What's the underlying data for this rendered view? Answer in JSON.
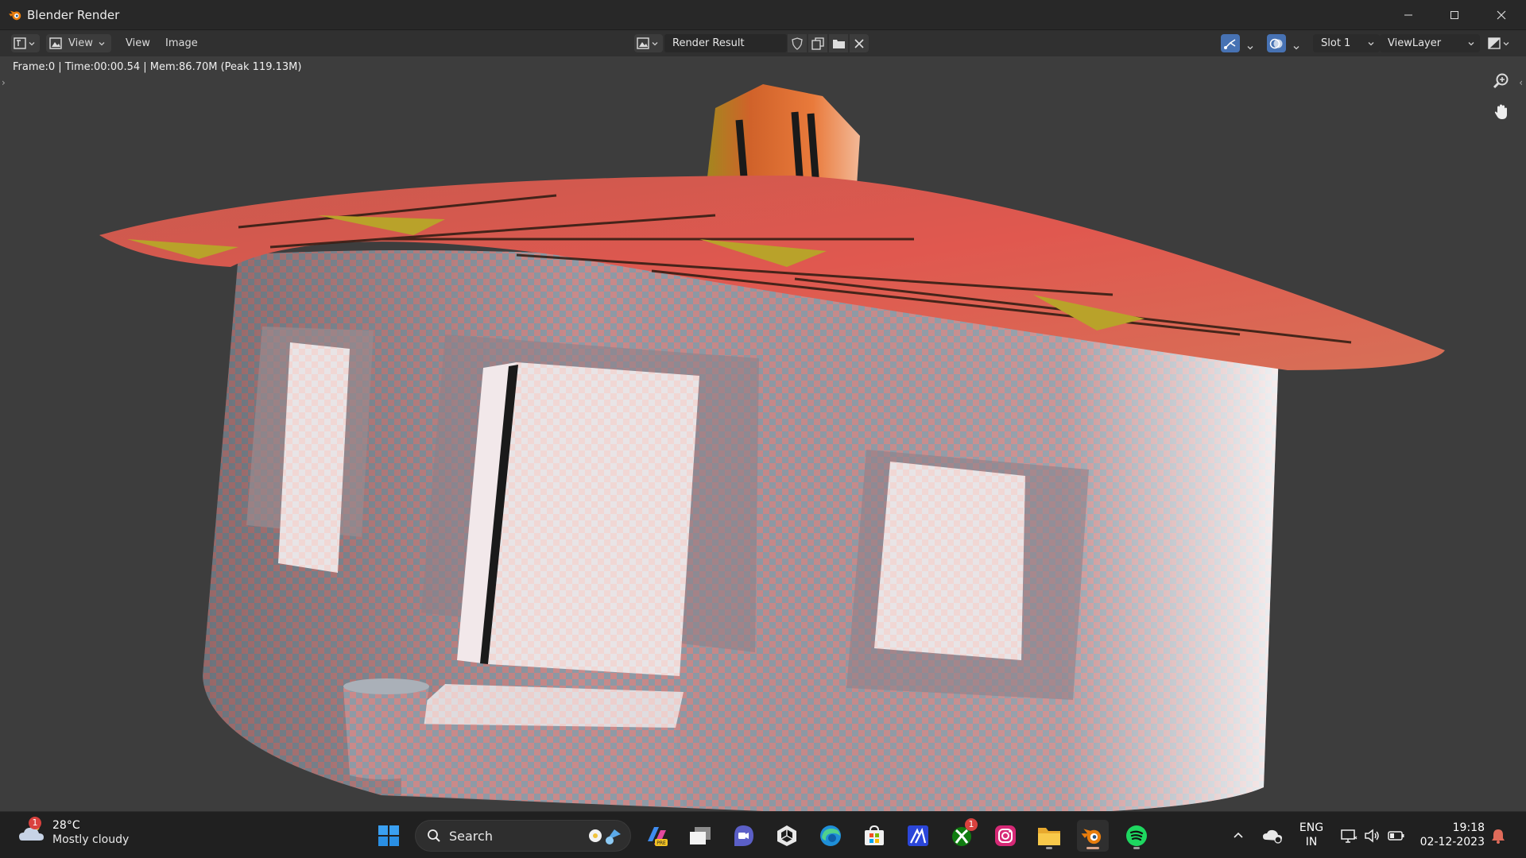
{
  "window": {
    "title": "Blender Render",
    "icons": {
      "app": "blender-icon",
      "minimize": "minimize-icon",
      "maximize": "maximize-icon",
      "close": "close-icon"
    }
  },
  "toolbar": {
    "editor_type_icon": "image-editor-icon",
    "view_mode_label": "View",
    "menus": [
      "View",
      "Image"
    ],
    "image_name": "Render Result",
    "slot": "Slot 1",
    "view_layer": "ViewLayer",
    "icons": [
      "fake-user-shield-icon",
      "duplicate-image-icon",
      "open-folder-icon",
      "unlink-x-icon",
      "gizmo-icon",
      "overlay-icon",
      "display-channels-icon"
    ]
  },
  "viewport": {
    "info": "Frame:0 | Time:00:00.54 | Mem:86.70M (Peak 119.13M)",
    "nav_icons": [
      "zoom-icon",
      "hand-pan-icon"
    ]
  },
  "taskbar": {
    "weather": {
      "badge": "1",
      "temp": "28°C",
      "desc": "Mostly cloudy"
    },
    "search_label": "Search",
    "pinned": [
      "windows-start-icon",
      "copilot-pre-icon",
      "task-view-icon",
      "meet-video-icon",
      "unity-icon",
      "edge-icon",
      "microsoft-store-icon",
      "affinity-icon",
      "xbox-icon",
      "instagram-icon",
      "file-explorer-icon",
      "blender-icon",
      "spotify-icon"
    ],
    "xbox_badge": "1",
    "tray": {
      "lang_line1": "ENG",
      "lang_line2": "IN",
      "time": "19:18",
      "date": "02-12-2023"
    }
  },
  "colors": {
    "accent_blue": "#4772b3",
    "background": "#3d3d3d",
    "titlebar": "#282828",
    "toolbar": "#303030"
  }
}
